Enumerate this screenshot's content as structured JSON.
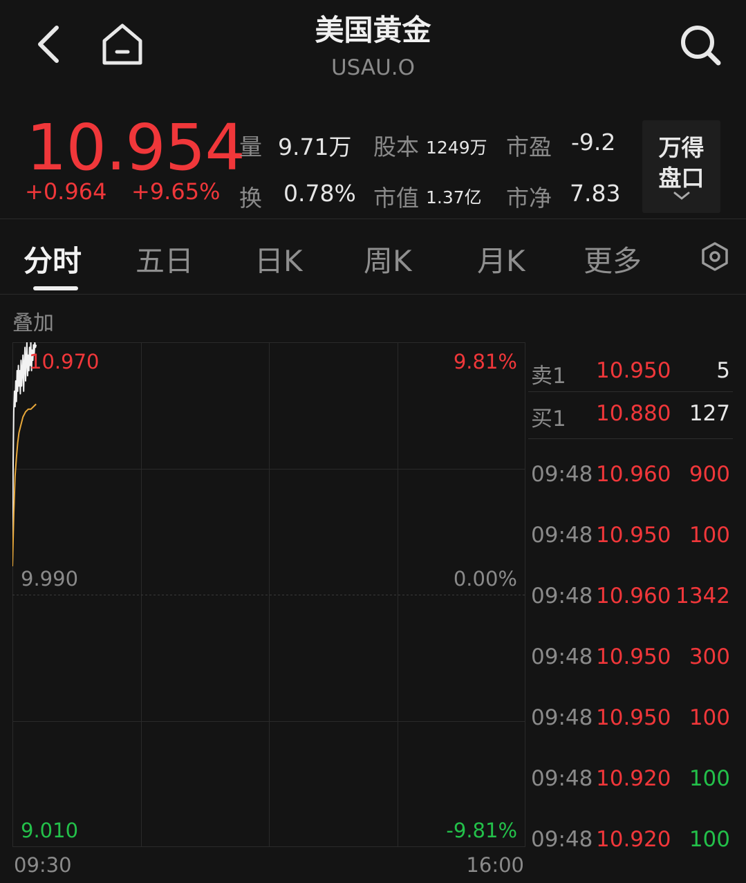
{
  "header": {
    "title": "美国黄金",
    "subtitle": "USAU.O",
    "back_icon": "chevron-left-icon",
    "home_icon": "home-icon",
    "search_icon": "search-icon"
  },
  "quote": {
    "price": "10.954",
    "change": "+0.964",
    "change_pct": "+9.65%",
    "stats": {
      "volume_label": "量",
      "volume": "9.71万",
      "share_cap_label": "股本",
      "share_cap": "1249万",
      "pe_label": "市盈",
      "pe": "-9.2",
      "turnover_label": "换",
      "turnover": "0.78%",
      "mkt_cap_label": "市值",
      "mkt_cap": "1.37亿",
      "pb_label": "市净",
      "pb": "7.83"
    },
    "wind_box": {
      "line1": "万得",
      "line2": "盘口"
    }
  },
  "tabs": [
    {
      "label": "分时",
      "active": true
    },
    {
      "label": "五日",
      "active": false
    },
    {
      "label": "日K",
      "active": false
    },
    {
      "label": "周K",
      "active": false
    },
    {
      "label": "月K",
      "active": false
    },
    {
      "label": "更多",
      "active": false
    }
  ],
  "chart_controls": {
    "overlay_label": "叠加",
    "settings_icon": "hexagon-settings-icon"
  },
  "chart_data": {
    "type": "line",
    "y_left_ticks": [
      "10.970",
      "9.990",
      "9.010"
    ],
    "y_right_ticks": [
      "9.81%",
      "0.00%",
      "-9.81%"
    ],
    "x_ticks": [
      "09:30",
      "16:00"
    ],
    "ylim": [
      9.01,
      10.97
    ],
    "prev_close": 9.99,
    "session_minutes": 390,
    "series": [
      {
        "kind": "price",
        "color": "#f2f2f2",
        "x": [
          0,
          0.5,
          1,
          1.5,
          2,
          2.5,
          3,
          3.5,
          4,
          4.5,
          5,
          5.5,
          6,
          6.5,
          7,
          7.5,
          8,
          8.5,
          9,
          9.5,
          10,
          10.5,
          11,
          11.5,
          12,
          12.5,
          13,
          13.5,
          14,
          14.5,
          15,
          15.5,
          16,
          16.5,
          17,
          17.5,
          18
        ],
        "values": [
          10.1,
          10.5,
          10.7,
          10.78,
          10.72,
          10.82,
          10.74,
          10.86,
          10.78,
          10.88,
          10.8,
          10.86,
          10.77,
          10.9,
          10.8,
          10.86,
          10.92,
          10.78,
          10.88,
          10.95,
          10.82,
          10.9,
          10.97,
          10.84,
          10.92,
          10.86,
          10.95,
          10.88,
          10.97,
          10.86,
          10.94,
          10.9,
          10.96,
          10.92,
          10.97,
          10.95,
          10.96
        ]
      },
      {
        "kind": "average",
        "color": "#e8a83a",
        "x": [
          0,
          1,
          2,
          3,
          4,
          5,
          6,
          7,
          8,
          9,
          10,
          12,
          14,
          16,
          18
        ],
        "values": [
          10.1,
          10.3,
          10.45,
          10.52,
          10.58,
          10.62,
          10.64,
          10.66,
          10.68,
          10.69,
          10.7,
          10.71,
          10.71,
          10.72,
          10.73
        ]
      }
    ]
  },
  "order_book": {
    "sell": {
      "label": "卖1",
      "price": "10.950",
      "qty": "5"
    },
    "buy": {
      "label": "买1",
      "price": "10.880",
      "qty": "127"
    },
    "trades": [
      {
        "time": "09:48",
        "price": "10.960",
        "qty": "900",
        "dir": "up"
      },
      {
        "time": "09:48",
        "price": "10.950",
        "qty": "100",
        "dir": "up"
      },
      {
        "time": "09:48",
        "price": "10.960",
        "qty": "1342",
        "dir": "up"
      },
      {
        "time": "09:48",
        "price": "10.950",
        "qty": "300",
        "dir": "up"
      },
      {
        "time": "09:48",
        "price": "10.950",
        "qty": "100",
        "dir": "up"
      },
      {
        "time": "09:48",
        "price": "10.920",
        "qty": "100",
        "dir": "down"
      },
      {
        "time": "09:48",
        "price": "10.920",
        "qty": "100",
        "dir": "down"
      }
    ]
  },
  "colors": {
    "background": "#141414",
    "up": "#f0373a",
    "down": "#23c04a",
    "muted": "#8a8a8a"
  }
}
